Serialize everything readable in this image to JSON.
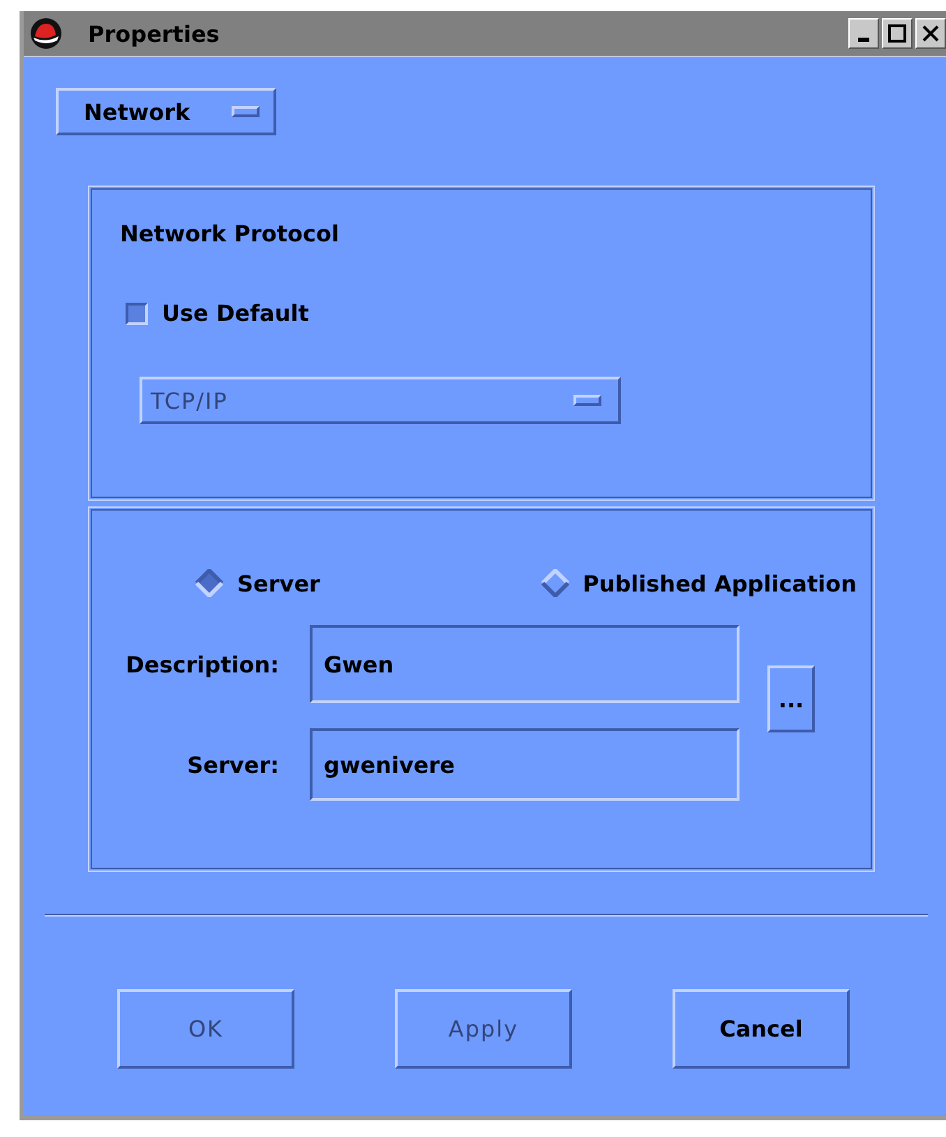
{
  "window": {
    "title": "Properties"
  },
  "category_menu": {
    "value": "Network"
  },
  "protocol_group": {
    "title": "Network Protocol",
    "use_default": {
      "label": "Use Default",
      "checked": true
    },
    "protocol_menu": {
      "value": "TCP/IP",
      "disabled": true
    }
  },
  "connection_group": {
    "options": [
      {
        "label": "Server",
        "selected": true
      },
      {
        "label": "Published Application",
        "selected": false
      }
    ],
    "fields": [
      {
        "label": "Description:",
        "value": "Gwen"
      },
      {
        "label": "Server:",
        "value": "gwenivere"
      }
    ],
    "browse_button": "..."
  },
  "buttons": [
    {
      "label": "OK",
      "disabled": true
    },
    {
      "label": "Apply",
      "disabled": true
    },
    {
      "label": "Cancel",
      "disabled": false
    }
  ]
}
